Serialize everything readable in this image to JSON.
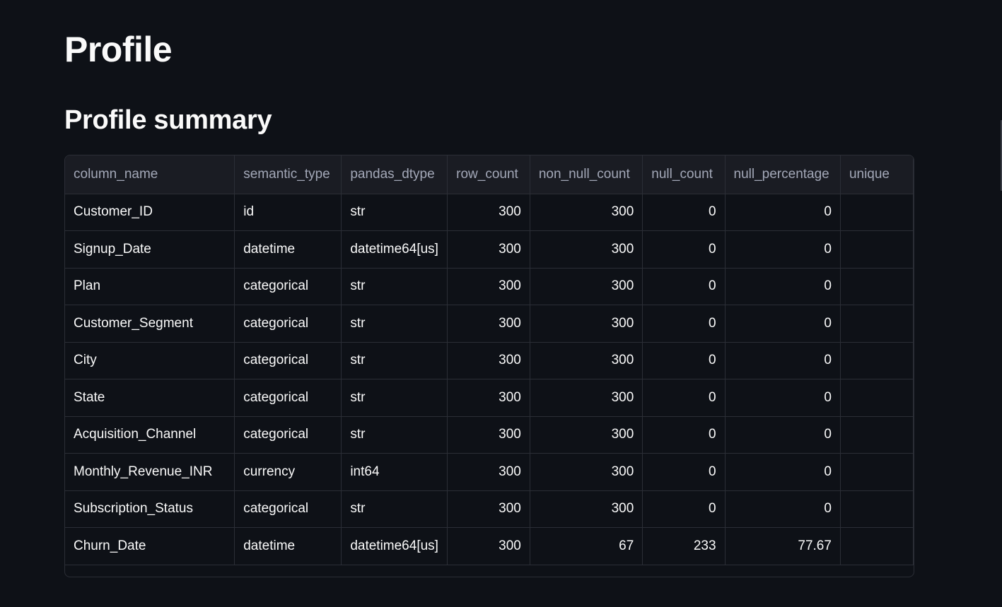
{
  "page": {
    "title": "Profile",
    "section_title": "Profile summary"
  },
  "table": {
    "columns": [
      "column_name",
      "semantic_type",
      "pandas_dtype",
      "row_count",
      "non_null_count",
      "null_count",
      "null_percentage",
      "unique"
    ],
    "rows": [
      [
        "Customer_ID",
        "id",
        "str",
        "300",
        "300",
        "0",
        "0",
        ""
      ],
      [
        "Signup_Date",
        "datetime",
        "datetime64[us]",
        "300",
        "300",
        "0",
        "0",
        ""
      ],
      [
        "Plan",
        "categorical",
        "str",
        "300",
        "300",
        "0",
        "0",
        ""
      ],
      [
        "Customer_Segment",
        "categorical",
        "str",
        "300",
        "300",
        "0",
        "0",
        ""
      ],
      [
        "City",
        "categorical",
        "str",
        "300",
        "300",
        "0",
        "0",
        ""
      ],
      [
        "State",
        "categorical",
        "str",
        "300",
        "300",
        "0",
        "0",
        ""
      ],
      [
        "Acquisition_Channel",
        "categorical",
        "str",
        "300",
        "300",
        "0",
        "0",
        ""
      ],
      [
        "Monthly_Revenue_INR",
        "currency",
        "int64",
        "300",
        "300",
        "0",
        "0",
        ""
      ],
      [
        "Subscription_Status",
        "categorical",
        "str",
        "300",
        "300",
        "0",
        "0",
        ""
      ],
      [
        "Churn_Date",
        "datetime",
        "datetime64[us]",
        "300",
        "67",
        "233",
        "77.67",
        ""
      ]
    ]
  },
  "colors": {
    "background": "#0e1117",
    "header_bg": "#1a1c23",
    "grid_line": "#2b2e36",
    "header_text": "#a3a8b8",
    "cell_text": "#fafafa"
  }
}
